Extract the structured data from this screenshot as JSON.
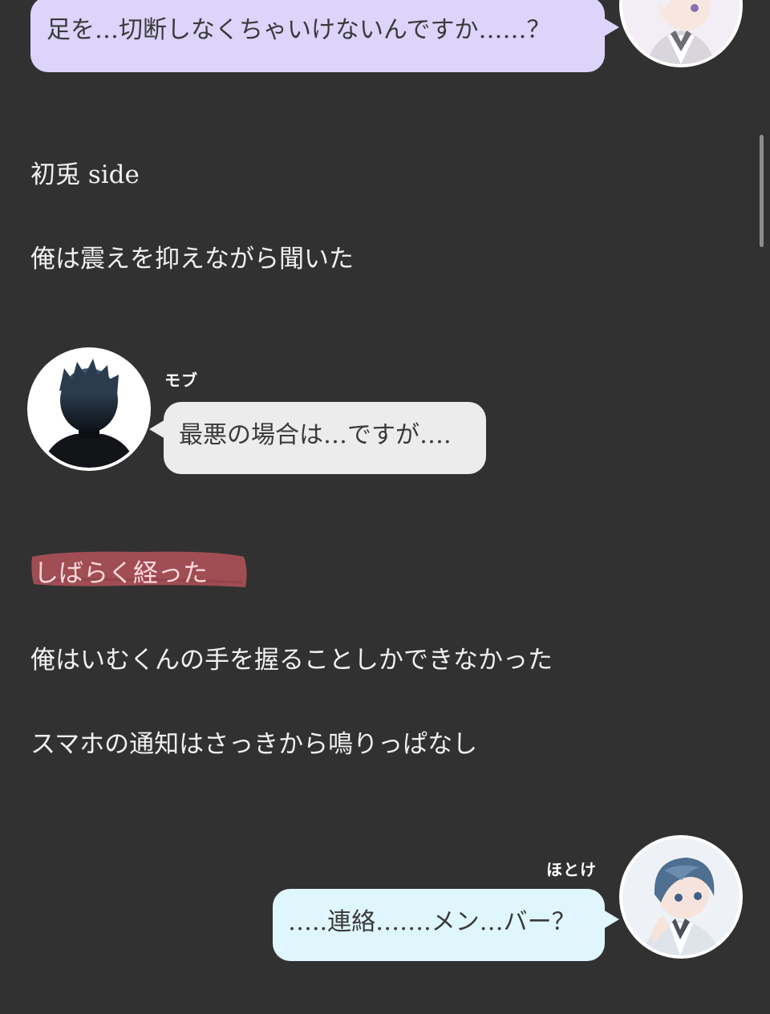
{
  "messages": {
    "top_bubble": "足を…切断しなくちゃいけないんですか……？",
    "mob_speaker": "モブ",
    "mob_bubble": "最悪の場合は…ですが….",
    "hotoke_speaker": "ほとけ",
    "hotoke_bubble": "…..連絡…….メン…バー？"
  },
  "narration": {
    "side_label": "初兎 side",
    "line1": "俺は震えを抑えながら聞いた",
    "time_skip": "しばらく経った",
    "line2": "俺はいむくんの手を握ることしかできなかった",
    "line3": "スマホの通知はさっきから鳴りっぱなし"
  },
  "colors": {
    "background": "#313131",
    "bubble_purple": "#ddd4fb",
    "bubble_grey": "#ececec",
    "bubble_blue": "#dff6fd",
    "highlight": "#a94f57"
  },
  "icons": {
    "top_avatar": "user-avatar-icon",
    "mob_avatar": "silhouette-avatar-icon",
    "hotoke_avatar": "user-avatar-icon"
  }
}
